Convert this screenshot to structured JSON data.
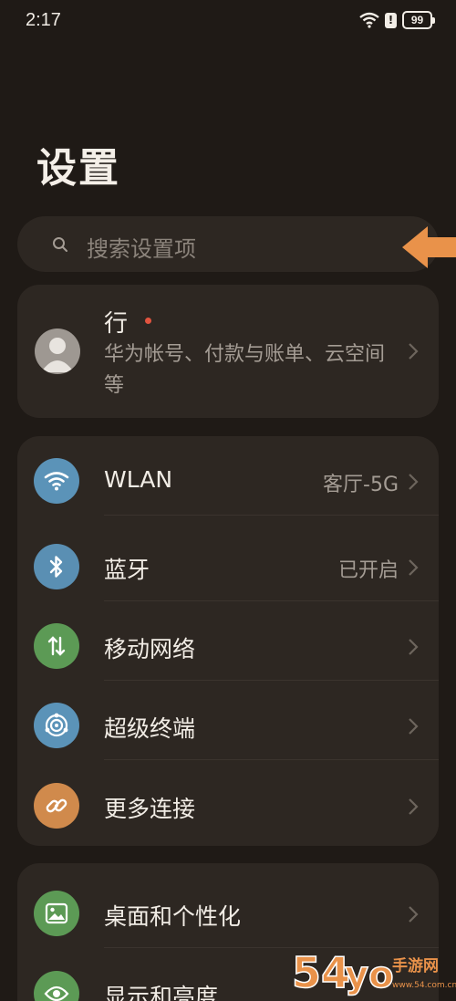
{
  "status_bar": {
    "time": "2:17",
    "battery": "99"
  },
  "header": {
    "title": "设置"
  },
  "search": {
    "placeholder": "搜索设置项"
  },
  "account": {
    "name": "行",
    "description": "华为帐号、付款与账单、云空间等"
  },
  "network": {
    "items": [
      {
        "label": "WLAN",
        "value": "客厅-5G",
        "icon": "wifi-icon",
        "color": "#5b93b8"
      },
      {
        "label": "蓝牙",
        "value": "已开启",
        "icon": "bluetooth-icon",
        "color": "#5a8fb3"
      },
      {
        "label": "移动网络",
        "value": "",
        "icon": "mobile-data-icon",
        "color": "#5c9a55"
      },
      {
        "label": "超级终端",
        "value": "",
        "icon": "super-device-icon",
        "color": "#5b93b8"
      },
      {
        "label": "更多连接",
        "value": "",
        "icon": "link-icon",
        "color": "#d08a4c"
      }
    ]
  },
  "personalization": {
    "items": [
      {
        "label": "桌面和个性化",
        "icon": "image-icon",
        "color": "#5c9a55"
      },
      {
        "label": "显示和亮度",
        "icon": "eye-icon",
        "color": "#5c9a55"
      }
    ]
  },
  "watermark": {
    "number": "54",
    "text": "手游网",
    "domain": "www.54.com.cn"
  },
  "colors": {
    "background": "#1f1a16",
    "card": "#2d2722",
    "arrow": "#e9924a"
  }
}
